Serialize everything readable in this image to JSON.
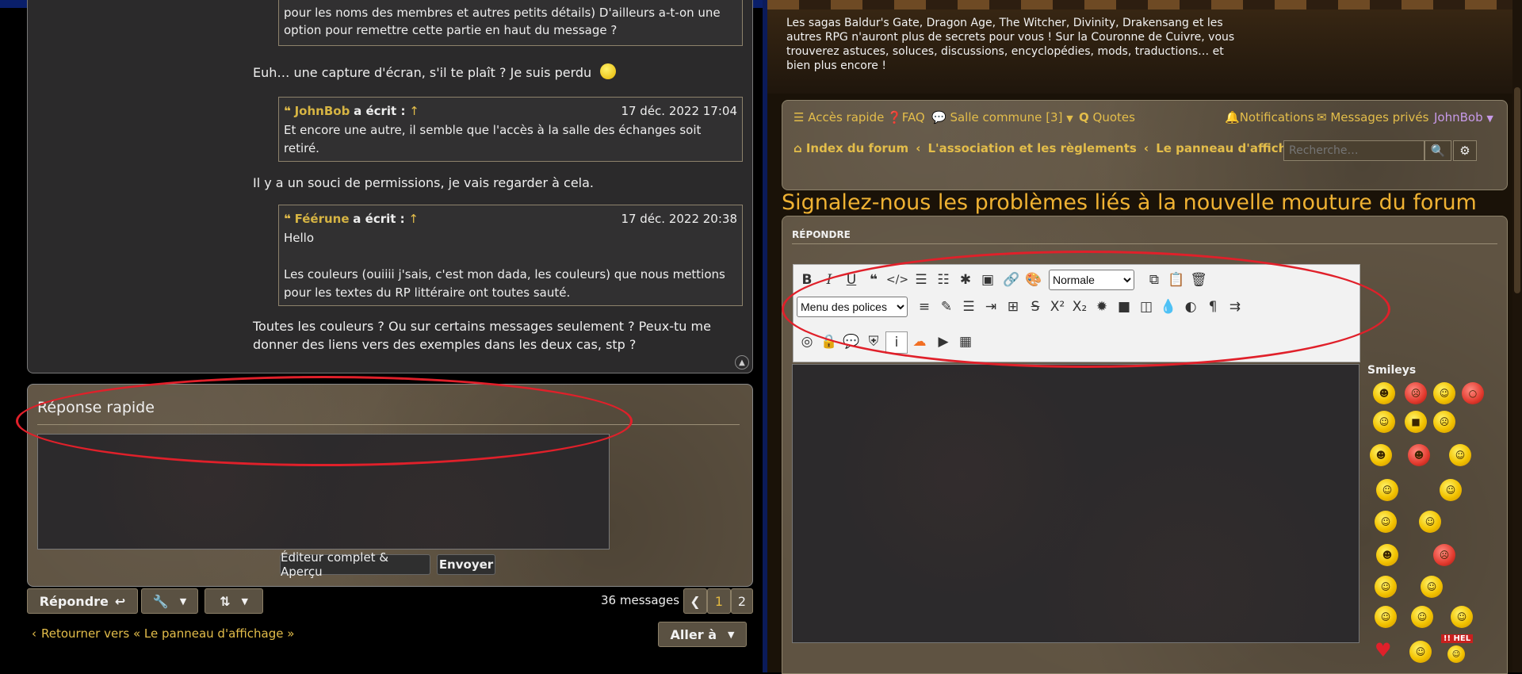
{
  "left": {
    "post": {
      "quote1_tail": "pour les noms des membres et autres petits détails) D'ailleurs a-t-on une option pour remettre cette partie en haut du message ?",
      "reply1": "Euh… une capture d'écran, s'il te plaît ? Je suis perdu",
      "quote2": {
        "author": "JohnBob",
        "wrote": "a écrit :",
        "arrow": "↑",
        "date": "17 déc. 2022 17:04",
        "text": "Et encore une autre, il semble que l'accès à la salle des échanges soit retiré."
      },
      "reply2": "Il y a un souci de permissions, je vais regarder à cela.",
      "quote3": {
        "author": "Féérune",
        "wrote": "a écrit :",
        "arrow": "↑",
        "date": "17 déc. 2022 20:38",
        "line1": "Hello",
        "line2": "Les couleurs (ouiiii j'sais, c'est mon dada, les couleurs) que nous mettions pour les textes du RP littéraire ont toutes sauté."
      },
      "reply3": "Toutes les couleurs ? Ou sur certains messages seulement ? Peux-tu me donner des liens vers des exemples dans les deux cas, stp ?"
    },
    "quick_reply": {
      "title": "Réponse rapide",
      "full_editor": "Éditeur complet & Aperçu",
      "send": "Envoyer"
    },
    "actions": {
      "reply": "Répondre",
      "messages_count": "36 messages",
      "pages": [
        "1",
        "2"
      ],
      "current_page": "1",
      "back_link": "Retourner vers « Le panneau d'affichage »",
      "goto": "Aller à"
    }
  },
  "right": {
    "banner_text": "Les sagas Baldur's Gate, Dragon Age, The Witcher, Divinity, Drakensang et les autres RPG n'auront plus de secrets pour vous ! Sur la Couronne de Cuivre, vous trouverez astuces, soluces, discussions, encyclopédies, mods, traductions… et bien plus encore !",
    "nav": {
      "quick_access": "Accès rapide",
      "faq": "FAQ",
      "common_room": "Salle commune",
      "common_room_count": "[3]",
      "quotes": "Quotes",
      "notifications": "Notifications",
      "private_messages": "Messages privés",
      "user": "JohnBob"
    },
    "breadcrumbs": [
      "Index du forum",
      "L'association et les règlements",
      "Le panneau d'affichage"
    ],
    "search_placeholder": "Recherche…",
    "title": "Signalez-nous les problèmes liés à la nouvelle mouture du forum",
    "section": "RÉPONDRE",
    "editor": {
      "size_select": "Normale",
      "font_select": "Menu des polices"
    },
    "smileys_label": "Smileys",
    "help_text": "!! HEL"
  },
  "colors": {
    "accent": "#e3bd4a",
    "title": "#efb233",
    "ellipse": "#e0202a"
  }
}
